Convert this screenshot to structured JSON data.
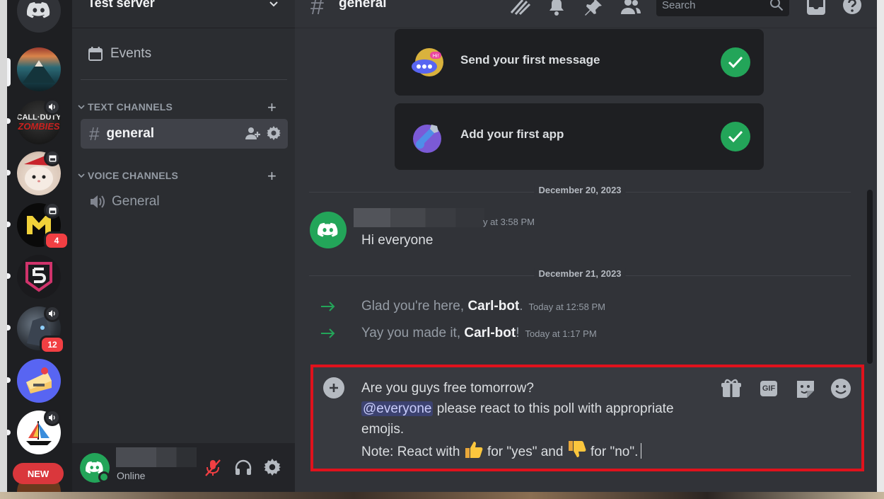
{
  "server": {
    "name": "Test server",
    "badges": [
      "4",
      "12"
    ],
    "new_label": "NEW"
  },
  "sidebar": {
    "events_label": "Events",
    "text_category": "TEXT CHANNELS",
    "voice_category": "VOICE CHANNELS",
    "text_channels": [
      {
        "name": "general"
      }
    ],
    "voice_channels": [
      {
        "name": "General"
      }
    ]
  },
  "user": {
    "status": "Online"
  },
  "channel": {
    "title": "general",
    "search_placeholder": "Search"
  },
  "onboarding": [
    {
      "label": "Send your first message",
      "done": true
    },
    {
      "label": "Add your first app",
      "done": true
    }
  ],
  "messages": {
    "date1": "December 20, 2023",
    "msg_time": "y at 3:58 PM",
    "msg_text": "Hi everyone",
    "date2": "December 21, 2023",
    "system": [
      {
        "prefix": "Glad you're here, ",
        "bot": "Carl-bot",
        "suffix": ".",
        "time": "Today at 12:58 PM"
      },
      {
        "prefix": "Yay you made it, ",
        "bot": "Carl-bot",
        "suffix": "!",
        "time": "Today at 1:17 PM"
      }
    ]
  },
  "composer": {
    "line1": "Are you guys free tomorrow?",
    "mention": "@everyone",
    "line2_rest": " please react to this poll with appropriate emojis.",
    "note_prefix": "Note: React with ",
    "yes_text": " for \"yes\" and ",
    "no_text": " for \"no\".",
    "gif_label": "GIF"
  },
  "colors": {
    "accent_green": "#23a559",
    "highlight_border": "#e0121c",
    "badge_red": "#f23f43",
    "background": "#313338"
  }
}
